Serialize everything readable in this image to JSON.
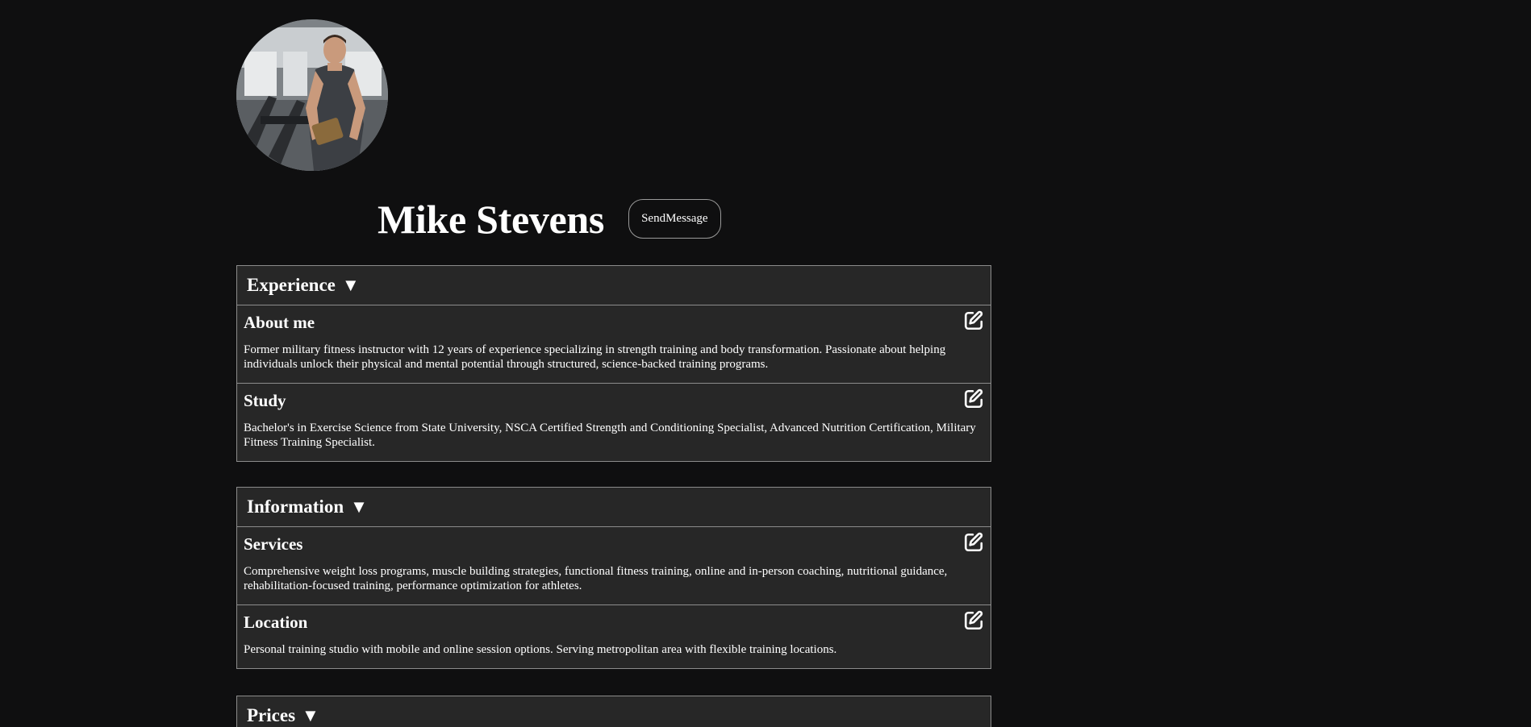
{
  "profile": {
    "name": "Mike Stevens",
    "send_message_label": "SendMessage",
    "avatar_icon": "profile-photo"
  },
  "sections": [
    {
      "title": "Experience",
      "toggle": "▼",
      "items": [
        {
          "title": "About me",
          "text": "Former military fitness instructor with 12 years of experience specializing in strength training and body transformation. Passionate about helping individuals unlock their physical and mental potential through structured, science-backed training programs."
        },
        {
          "title": "Study",
          "text": "Bachelor's in Exercise Science from State University, NSCA Certified Strength and Conditioning Specialist, Advanced Nutrition Certification, Military Fitness Training Specialist."
        }
      ]
    },
    {
      "title": "Information",
      "toggle": "▼",
      "items": [
        {
          "title": "Services",
          "text": "Comprehensive weight loss programs, muscle building strategies, functional fitness training, online and in-person coaching, nutritional guidance, rehabilitation-focused training, performance optimization for athletes."
        },
        {
          "title": "Location",
          "text": "Personal training studio with mobile and online session options. Serving metropolitan area with flexible training locations."
        }
      ]
    },
    {
      "title": "Prices",
      "toggle": "▼",
      "items": []
    }
  ],
  "icons": {
    "edit": "edit-icon"
  },
  "colors": {
    "background": "#0f0f10",
    "panel": "#272727",
    "border": "#8c8c8c",
    "text": "#ffffff"
  }
}
